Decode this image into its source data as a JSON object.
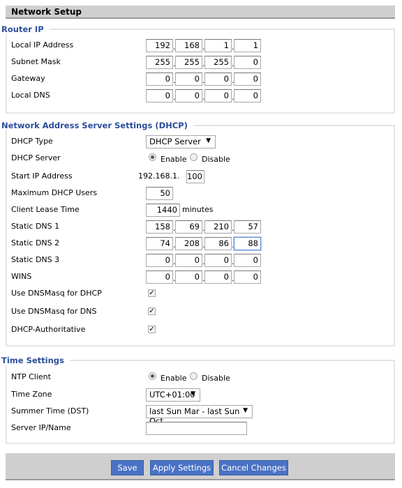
{
  "header": {
    "title": "Network Setup"
  },
  "router_ip": {
    "legend": "Router IP",
    "rows": [
      {
        "label": "Local IP Address",
        "octets": [
          "192",
          "168",
          "1",
          "1"
        ]
      },
      {
        "label": "Subnet Mask",
        "octets": [
          "255",
          "255",
          "255",
          "0"
        ]
      },
      {
        "label": "Gateway",
        "octets": [
          "0",
          "0",
          "0",
          "0"
        ]
      },
      {
        "label": "Local DNS",
        "octets": [
          "0",
          "0",
          "0",
          "0"
        ]
      }
    ]
  },
  "dhcp": {
    "legend": "Network Address Server Settings (DHCP)",
    "type_label": "DHCP Type",
    "type_value": "DHCP Server",
    "server_label": "DHCP Server",
    "enable": "Enable",
    "disable": "Disable",
    "server_enabled": true,
    "start_ip_label": "Start IP Address",
    "start_ip_prefix": "192.168.1.",
    "start_ip_value": "100",
    "max_users_label": "Maximum DHCP Users",
    "max_users_value": "50",
    "lease_label": "Client Lease Time",
    "lease_value": "1440",
    "lease_unit": "minutes",
    "ip_rows": [
      {
        "label": "Static DNS 1",
        "octets": [
          "158",
          "69",
          "210",
          "57"
        ]
      },
      {
        "label": "Static DNS 2",
        "octets": [
          "74",
          "208",
          "86",
          "88"
        ]
      },
      {
        "label": "Static DNS 3",
        "octets": [
          "0",
          "0",
          "0",
          "0"
        ]
      },
      {
        "label": "WINS",
        "octets": [
          "0",
          "0",
          "0",
          "0"
        ]
      }
    ],
    "checks": [
      {
        "label": "Use DNSMasq for DHCP",
        "checked": true
      },
      {
        "label": "Use DNSMasq for DNS",
        "checked": true
      },
      {
        "label": "DHCP-Authoritative",
        "checked": true
      }
    ]
  },
  "time": {
    "legend": "Time Settings",
    "ntp_label": "NTP Client",
    "enable": "Enable",
    "disable": "Disable",
    "ntp_enabled": true,
    "tz_label": "Time Zone",
    "tz_value": "UTC+01:00",
    "dst_label": "Summer Time (DST)",
    "dst_value": "last Sun Mar - last Sun Oct",
    "server_label": "Server IP/Name",
    "server_value": ""
  },
  "buttons": {
    "save": "Save",
    "apply": "Apply Settings",
    "cancel": "Cancel Changes"
  },
  "colors": {
    "accent": "#4a72c4",
    "legend": "#2b4d9a"
  }
}
